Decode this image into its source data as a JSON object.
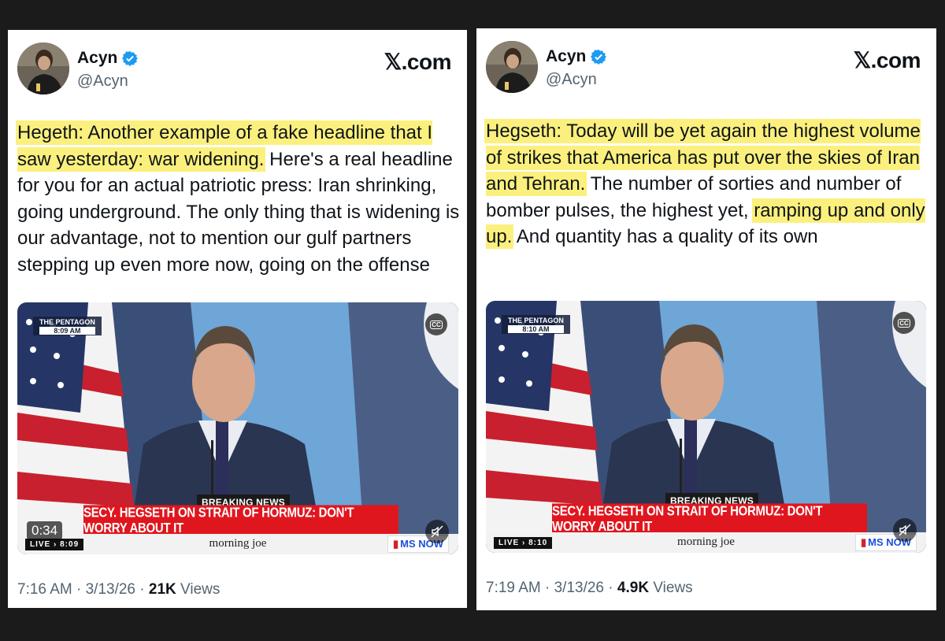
{
  "tweets": [
    {
      "author_name": "Acyn",
      "handle": "@Acyn",
      "brand": "𝕏.com",
      "text_highlighted": "Hegeth: Another example of a fake headline that I saw yesterday: war widening.",
      "text_rest": " Here's a real headline for you for an actual patriotic press: Iran shrinking, going underground. The only thing that is widening is our advantage, not to mention our gulf partners stepping up even more now, going on the offense",
      "video": {
        "location": "THE PENTAGON",
        "location_time": "8:09 AM",
        "cc": "CC",
        "breaking": "BREAKING NEWS",
        "headline": "SECY. HEGSETH ON STRAIT OF HORMUZ: DON'T WORRY ABOUT IT",
        "live": "LIVE",
        "live_time": "8:09",
        "show": "morning joe",
        "network": "MS NOW",
        "duration": "0:34"
      },
      "time": "7:16 AM",
      "date": "3/13/26",
      "views_count": "21K",
      "views_label": "Views"
    },
    {
      "author_name": "Acyn",
      "handle": "@Acyn",
      "brand": "𝕏.com",
      "text_highlighted_1": "Hegseth: Today will be yet again the highest volume of strikes that America has put over the skies of Iran and Tehran.",
      "text_mid": " The number of sorties and number of bomber pulses, the highest yet, ",
      "text_highlighted_2": "ramping up and only up.",
      "text_rest": " And quantity has a quality of its own",
      "video": {
        "location": "THE PENTAGON",
        "location_time": "8:10 AM",
        "cc": "CC",
        "breaking": "BREAKING NEWS",
        "headline": "SECY. HEGSETH ON STRAIT OF HORMUZ: DON'T WORRY ABOUT IT",
        "live": "LIVE",
        "live_time": "8:10",
        "show": "morning joe",
        "network": "MS NOW"
      },
      "time": "7:19 AM",
      "date": "3/13/26",
      "views_count": "4.9K",
      "views_label": "Views"
    }
  ],
  "colors": {
    "highlight": "#fbf07d",
    "verified": "#1d9bf0",
    "chyron_red": "#e0161e"
  }
}
